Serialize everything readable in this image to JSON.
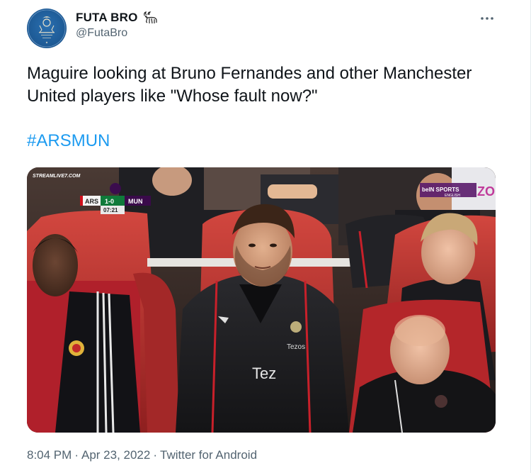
{
  "author": {
    "display_name": "FUTA BRO",
    "handle": "@FutaBro",
    "avatar_icon": "futa-logo-icon",
    "badge_icon": "goat-icon"
  },
  "tweet": {
    "text": "Maguire looking at Bruno Fernandes and other Manchester United players like \"Whose fault now?\"",
    "hashtag": "#ARSMUN"
  },
  "media": {
    "watermark": "STREAMLIVE7.COM",
    "scoreboard": {
      "home": "ARS",
      "score": "1-0",
      "away": "MUN",
      "clock": "07:21"
    },
    "broadcaster": "beIN SPORTS",
    "broadcaster_sub": "ENGLISH",
    "jersey_text": "Tez",
    "sponsor_text": "Tezos"
  },
  "meta": {
    "time": "8:04 PM",
    "date": "Apr 23, 2022",
    "client": "Twitter for Android",
    "separator": "·"
  },
  "colors": {
    "link": "#1d9bf0",
    "secondary_text": "#536471",
    "primary_text": "#0f1419"
  }
}
